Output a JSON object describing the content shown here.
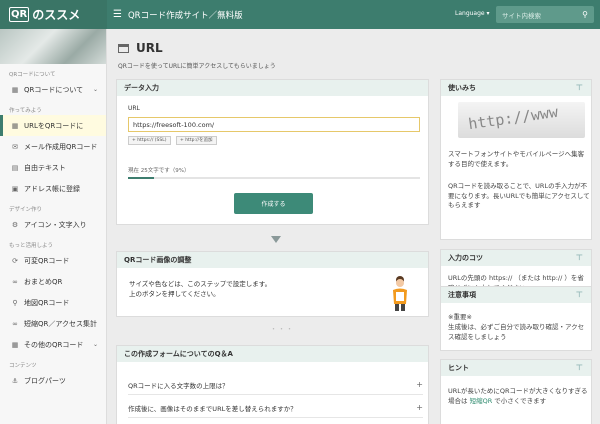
{
  "header": {
    "logo_mark": "QR",
    "logo_text": "のススメ",
    "menu_icon": "hamburger-icon",
    "site_title": "QRコード作成サイト／無料版",
    "language": "Language ▾",
    "search_placeholder": "サイト内検索",
    "brand_color": "#3d7d6e"
  },
  "sidebar": {
    "sections": [
      {
        "label": "QRコードについて",
        "items": [
          {
            "label": "QRコードについて",
            "icon": "qr-icon",
            "expand": "⌄"
          }
        ]
      },
      {
        "label": "作ってみよう",
        "items": [
          {
            "label": "URLをQRコードに",
            "icon": "qr-icon",
            "active": true
          },
          {
            "label": "メール作成用QRコード",
            "icon": "mail-icon"
          },
          {
            "label": "自由テキスト",
            "icon": "text-icon"
          },
          {
            "label": "アドレス帳に登録",
            "icon": "contact-icon"
          }
        ]
      },
      {
        "label": "デザイン作り",
        "items": [
          {
            "label": "アイコン・文字入り",
            "icon": "gear-icon"
          }
        ]
      },
      {
        "label": "もっと活用しよう",
        "items": [
          {
            "label": "可変QRコード",
            "icon": "refresh-icon"
          },
          {
            "label": "おまとめQR",
            "icon": "link-icon"
          },
          {
            "label": "地図QRコード",
            "icon": "pin-icon"
          },
          {
            "label": "短縮QR／アクセス集計",
            "icon": "link-icon"
          },
          {
            "label": "その他のQRコード",
            "icon": "grid-icon",
            "expand": "⌄"
          }
        ]
      },
      {
        "label": "コンテンツ",
        "items": [
          {
            "label": "ブログパーツ",
            "icon": "blog-icon"
          }
        ]
      }
    ]
  },
  "main": {
    "title": "URL",
    "subtitle": "QRコードを使ってURLに簡単アクセスしてもらいましょう",
    "data_input": {
      "heading": "データ入力",
      "url_label": "URL",
      "url_value": "https://freesoft-100.com/",
      "chip_ssl": "+ https:// (SSL)",
      "chip_http": "+ http://を追加",
      "count_text": "現在 25文字です（9%）",
      "progress_percent": 9,
      "create_button": "作成する"
    },
    "image_adjust": {
      "heading": "QRコード画像の調整",
      "line1": "サイズや色などは、このステップで設定します。",
      "line2": "上のボタンを押してください。"
    },
    "faq": {
      "heading": "この作成フォームについてのQ＆A",
      "rows": [
        {
          "q": "QRコードに入る文字数の上限は？",
          "icon": "+"
        },
        {
          "q": "作成後に、画像はそのままでURLを差し替えられますか？",
          "icon": "+"
        }
      ]
    },
    "more_dots": "・・・"
  },
  "right": {
    "usage": {
      "heading": "使いみち",
      "image_text": "http://www",
      "text1": "スマートフォンサイトやモバイルページへ集客する目的で使えます。",
      "text2": "QRコードを読み取ることで、URLの手入力が不要になります。長いURLでも簡単にアクセスしてもらえます"
    },
    "tips": {
      "heading": "入力のコツ",
      "text": "URLの先頭の https:// （または http:// ）を省略せずに入力してください"
    },
    "notes": {
      "heading": "注意事項",
      "text1": "※重要※",
      "text2": "生成後は、必ずご自分で読み取り確認・アクセス確認をしましょう"
    },
    "hint": {
      "heading": "ヒント",
      "text_a": "URLが長いためにQRコードが大きくなりすぎる場合は ",
      "text_link": "短縮QR",
      "text_b": " で小さくできます"
    }
  }
}
